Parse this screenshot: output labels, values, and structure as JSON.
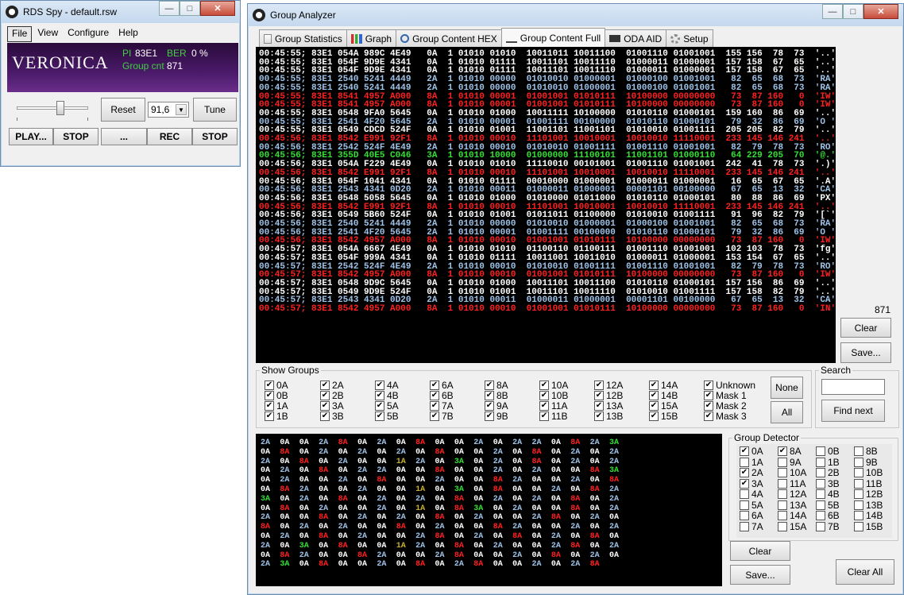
{
  "rds": {
    "title": "RDS Spy - default.rsw",
    "menu": [
      "File",
      "View",
      "Configure",
      "Help"
    ],
    "ps": "VERONICA",
    "pi_label": "PI",
    "pi_value": "83E1",
    "ber_label": "BER",
    "ber_value": "0 %",
    "group_cnt_label": "Group cnt",
    "group_cnt_value": "871",
    "reset": "Reset",
    "freq": "91,6",
    "tune": "Tune",
    "play": "PLAY...",
    "stop1": "STOP",
    "dots": "...",
    "rec": "REC",
    "stop2": "STOP"
  },
  "ga": {
    "title": "Group Analyzer",
    "tabs": [
      "Group Statistics",
      "Graph",
      "Group Content HEX",
      "Group Content Full",
      "ODA AID",
      "Setup"
    ],
    "count": "871",
    "clear": "Clear",
    "save": "Save...",
    "show_groups_label": "Show Groups",
    "none": "None",
    "all": "All",
    "search_label": "Search",
    "search_value": "",
    "find_next": "Find next",
    "detector_label": "Group Detector",
    "detector_clear": "Clear",
    "detector_save": "Save...",
    "clear_all": "Clear All"
  },
  "log": [
    [
      "w",
      "00:45:55; 83E1 054A 989C 4E49   0A  1 01010 01010  10011011 10011100  01001110 01001001  155 156  78  73  '..' 'NI'"
    ],
    [
      "w",
      "00:45:55; 83E1 054F 9D9E 4341   0A  1 01010 01111  10011101 10011110  01000011 01000001  157 158  67  65  '..' 'CA'"
    ],
    [
      "w",
      "00:45:55; 83E1 054F 9D9E 4341   0A  1 01010 01111  10011101 10011110  01000011 01000001  157 158  67  65  '..' 'CA'"
    ],
    [
      "b",
      "00:45:55; 83E1 2540 5241 4449   2A  1 01010 00000  01010010 01000001  01000100 01001001   82  65  68  73  'RA' 'DI'"
    ],
    [
      "b",
      "00:45:55; 83E1 2540 5241 4449   2A  1 01010 00000  01010010 01000001  01000100 01001001   82  65  68  73  'RA' 'DI'"
    ],
    [
      "r",
      "00:45:55; 83E1 8541 4957 A000   8A  1 01010 00001  01001001 01010111  10100000 00000000   73  87 160   0  'IW' '..'"
    ],
    [
      "r",
      "00:45:55; 83E1 8541 4957 A000   8A  1 01010 00001  01001001 01010111  10100000 00000000   73  87 160   0  'IW' '..'"
    ],
    [
      "w",
      "00:45:55; 83E1 0548 9FA0 5645   0A  1 01010 01000  10011111 10100000  01010110 01000101  159 160  86  69  '..' 'VE'"
    ],
    [
      "b",
      "00:45:55; 83E1 2541 4F20 5645   2A  1 01010 00001  01001111 00100000  01010110 01000101   79  32  86  69  'O ' 'VE'"
    ],
    [
      "w",
      "00:45:55; 83E1 0549 CDCD 524F   0A  1 01010 01001  11001101 11001101  01010010 01001111  205 205  82  79  '..' 'RO'"
    ],
    [
      "r",
      "00:45:56; 83E1 8542 E991 92F1   8A  1 01010 00010  11101001 10010001  10010010 11110001  233 145 146 241  '..' '..'"
    ],
    [
      "b",
      "00:45:56; 83E1 2542 524F 4E49   2A  1 01010 00010  01010010 01001111  01001110 01001001   82  79  78  73  'RO' 'NI'"
    ],
    [
      "g",
      "00:45:56; 83E1 355D 40E5 C046   3A  1 01010 10000  01000000 11100101  11001101 01000110   64 229 205  70  '@.' '.F'"
    ],
    [
      "w",
      "00:45:56; 83E1 054A F229 4E49   0A  1 01010 01010  11110010 00101001  01001110 01001001  242  41  78  73  '.)' 'NI'"
    ],
    [
      "r",
      "00:45:56; 83E1 8542 E991 92F1   8A  1 01010 00010  11101001 10010001  10010010 11110001  233 145 146 241  '..' '..'"
    ],
    [
      "w",
      "00:45:56; 83E1 054F 1041 4341   0A  1 01010 01111  00010000 01000001  01000011 01000001   16  65  67  65  '.A' 'CA'"
    ],
    [
      "b",
      "00:45:56; 83E1 2543 4341 0D20   2A  1 01010 00011  01000011 01000001  00001101 00100000   67  65  13  32  'CA' '. '"
    ],
    [
      "w",
      "00:45:56; 83E1 0548 5058 5645   0A  1 01010 01000  01010000 01011000  01010110 01000101   80  88  86  69  'PX' 'VE'"
    ],
    [
      "r",
      "00:45:56; 83E1 8542 E991 92F1   8A  1 01010 00010  11101001 10010001  10010010 11110001  233 145 146 241  '..' '..'"
    ],
    [
      "w",
      "00:45:56; 83E1 0549 5B60 524F   0A  1 01010 01001  01011011 01100000  01010010 01001111   91  96  82  79  '[`' 'RO'"
    ],
    [
      "b",
      "00:45:56; 83E1 2540 5241 4449   2A  1 01010 00000  01010010 01000001  01000100 01001001   82  65  68  73  'RA' 'DI'"
    ],
    [
      "b",
      "00:45:56; 83E1 2541 4F20 5645   2A  1 01010 00001  01001111 00100000  01010110 01000101   79  32  86  69  'O ' 'VE'"
    ],
    [
      "r",
      "00:45:56; 83E1 8542 4957 A000   8A  1 01010 00010  01001001 01010111  10100000 00000000   73  87 160   0  'IW' '..'"
    ],
    [
      "w",
      "00:45:57; 83E1 054A 6667 4E49   0A  1 01010 01010  01100110 01100111  01001110 01001001  102 103  78  73  'fg' 'NI'"
    ],
    [
      "w",
      "00:45:57; 83E1 054F 999A 4341   0A  1 01010 01111  10011001 10011010  01000011 01000001  153 154  67  65  '..' 'CA'"
    ],
    [
      "b",
      "00:45:57; 83E1 2542 524F 4E49   2A  1 01010 00010  01010010 01001111  01001110 01001001   82  79  78  73  'RO' 'NI'"
    ],
    [
      "r",
      "00:45:57; 83E1 8542 4957 A000   8A  1 01010 00010  01001001 01010111  10100000 00000000   73  87 160   0  'IW' '..'"
    ],
    [
      "w",
      "00:45:57; 83E1 0548 9D9C 5645   0A  1 01010 01000  10011101 10011100  01010110 01000101  157 156  86  69  '..' 'VE'"
    ],
    [
      "w",
      "00:45:57; 83E1 0549 9D9E 524F   0A  1 01010 01001  10011101 10011110  01010010 01001111  157 158  82  79  '..' 'RO'"
    ],
    [
      "b",
      "00:45:57; 83E1 2543 4341 0D20   2A  1 01010 00011  01000011 01000001  00001101 00100000   67  65  13  32  'CA' '. '"
    ],
    [
      "r",
      "00:45:57; 83E1 8542 4957 A000   8A  1 01010 00010  01001001 01010111  10100000 00000000   73  87 160   0  'IN' '..'"
    ]
  ],
  "show_groups": [
    [
      "0A",
      "2A",
      "4A",
      "6A",
      "8A",
      "10A",
      "12A",
      "14A",
      "Unknown"
    ],
    [
      "0B",
      "2B",
      "4B",
      "6B",
      "8B",
      "10B",
      "12B",
      "14B",
      "Mask 1"
    ],
    [
      "1A",
      "3A",
      "5A",
      "7A",
      "9A",
      "11A",
      "13A",
      "15A",
      "Mask 2"
    ],
    [
      "1B",
      "3B",
      "5B",
      "7B",
      "9B",
      "11B",
      "13B",
      "15B",
      "Mask 3"
    ]
  ],
  "detector": [
    [
      [
        "0A",
        true
      ],
      [
        "8A",
        true
      ],
      [
        "0B",
        false
      ],
      [
        "8B",
        false
      ]
    ],
    [
      [
        "1A",
        false
      ],
      [
        "9A",
        false
      ],
      [
        "1B",
        false
      ],
      [
        "9B",
        false
      ]
    ],
    [
      [
        "2A",
        true
      ],
      [
        "10A",
        false
      ],
      [
        "2B",
        false
      ],
      [
        "10B",
        false
      ]
    ],
    [
      [
        "3A",
        true
      ],
      [
        "11A",
        false
      ],
      [
        "3B",
        false
      ],
      [
        "11B",
        false
      ]
    ],
    [
      [
        "4A",
        false
      ],
      [
        "12A",
        false
      ],
      [
        "4B",
        false
      ],
      [
        "12B",
        false
      ]
    ],
    [
      [
        "5A",
        false
      ],
      [
        "13A",
        false
      ],
      [
        "5B",
        false
      ],
      [
        "13B",
        false
      ]
    ],
    [
      [
        "6A",
        false
      ],
      [
        "14A",
        false
      ],
      [
        "6B",
        false
      ],
      [
        "14B",
        false
      ]
    ],
    [
      [
        "7A",
        false
      ],
      [
        "15A",
        false
      ],
      [
        "7B",
        false
      ],
      [
        "15B",
        false
      ]
    ]
  ],
  "grid": [
    "2A 0A 0A 2A 8A 0A 2A 0A 8A 0A 0A 2A 0A 2A 2A 0A 8A 2A 3A",
    "0A 8A 0A 2A 0A 2A 0A 2A 0A 8A 0A 0A 2A 0A 8A 0A 2A 0A 2A",
    "2A 0A 8A 0A 2A 0A 0A 1A 2A 0A 3A 0A 2A 0A 8A 0A 2A 0A 2A",
    "0A 2A 0A 8A 0A 2A 2A 0A 0A 8A 0A 0A 2A 0A 2A 0A 0A 8A 3A",
    "0A 2A 0A 0A 2A 0A 8A 0A 0A 2A 0A 0A 8A 2A 0A 0A 2A 0A 8A",
    "0A 8A 2A 0A 0A 2A 0A 0A 1A 0A 3A 0A 8A 0A 0A 2A 0A 8A 2A",
    "3A 0A 2A 0A 8A 0A 2A 0A 2A 0A 8A 0A 2A 0A 2A 0A 8A 0A 2A",
    "0A 8A 0A 2A 0A 0A 2A 0A 1A 0A 8A 3A 0A 2A 0A 0A 8A 0A 2A",
    "2A 0A 0A 8A 0A 2A 0A 2A 0A 8A 0A 2A 0A 0A 2A 8A 0A 2A 0A",
    "8A 0A 2A 0A 2A 0A 0A 8A 0A 2A 0A 0A 8A 2A 0A 0A 2A 0A 2A",
    "0A 2A 0A 8A 0A 2A 0A 0A 2A 8A 0A 2A 0A 8A 0A 2A 0A 8A 0A",
    "2A 0A 3A 0A 8A 0A 0A 1A 2A 0A 8A 0A 2A 0A 0A 2A 8A 0A 2A",
    "0A 8A 2A 0A 0A 8A 2A 0A 0A 2A 8A 0A 0A 2A 0A 8A 0A 2A 0A",
    "2A 3A 0A 8A 0A 0A 2A 0A 8A 0A 2A 8A 0A 0A 2A 0A 2A 8A"
  ],
  "colors": {
    "white": "#ffffff",
    "blue": "#9fc3e8",
    "red": "#ff2020",
    "green": "#35e035",
    "olive": "#c8b030"
  }
}
